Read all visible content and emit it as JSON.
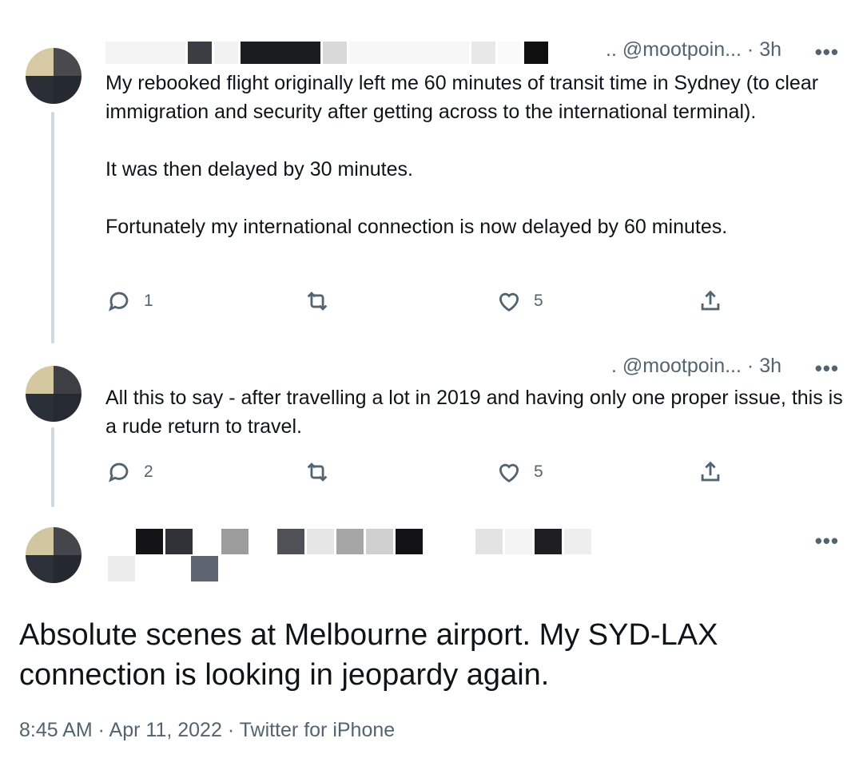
{
  "tweets": [
    {
      "handle": ".. @mootpoin...",
      "separator": "·",
      "time": "3h",
      "more": "•••",
      "paragraphs": [
        "My rebooked flight originally left me 60 minutes of transit time in Sydney (to clear immigration and security after getting across to the international terminal).",
        "It was then delayed by 30 minutes.",
        "Fortunately my international connection is now delayed by 60 minutes."
      ],
      "reply_count": "1",
      "like_count": "5"
    },
    {
      "handle": ". @mootpoin...",
      "separator": "·",
      "time": "3h",
      "more": "•••",
      "paragraphs": [
        "All this to say - after travelling a lot in 2019 and having only one proper issue, this is a rude return to travel."
      ],
      "reply_count": "2",
      "like_count": "5"
    }
  ],
  "main_tweet": {
    "more": "•••",
    "text": "Absolute scenes at Melbourne airport. My SYD-LAX connection is looking in jeopardy again.",
    "timestamp": "8:45 AM · Apr 11, 2022 · Twitter for iPhone"
  },
  "icons": {
    "reply": "reply-icon",
    "retweet": "retweet-icon",
    "like": "like-icon",
    "share": "share-icon",
    "more": "more-options-icon"
  },
  "colors": {
    "text": "#0f1419",
    "secondary": "#536471",
    "thread_line": "#cfd9de"
  }
}
